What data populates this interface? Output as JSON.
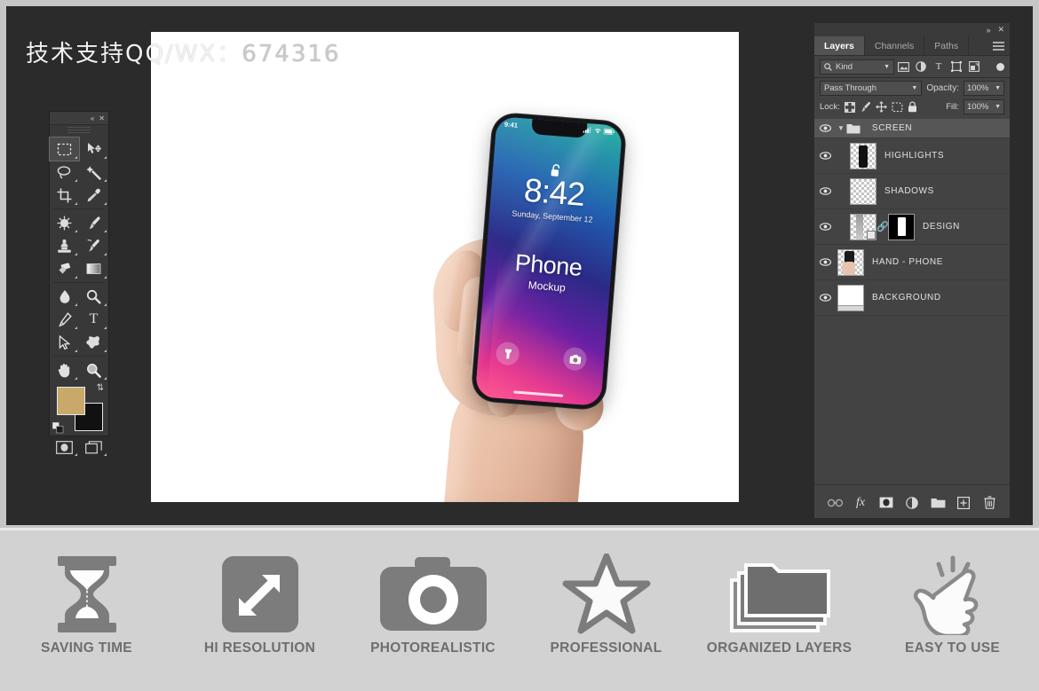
{
  "watermark": {
    "prefix": "技术支持QQ/WX：",
    "code": "674316"
  },
  "toolbar": {
    "collapse_icon": "double-chevron-left",
    "close_icon": "close",
    "tools": [
      {
        "name": "rectangular-marquee-tool",
        "selected": true
      },
      {
        "name": "move-tool",
        "selected": false
      },
      {
        "name": "lasso-tool",
        "selected": false
      },
      {
        "name": "magic-wand-tool",
        "selected": false
      },
      {
        "name": "crop-tool",
        "selected": false
      },
      {
        "name": "eyedropper-tool",
        "selected": false
      },
      {
        "name": "spot-healing-brush-tool",
        "selected": false
      },
      {
        "name": "brush-tool",
        "selected": false
      },
      {
        "name": "clone-stamp-tool",
        "selected": false
      },
      {
        "name": "history-brush-tool",
        "selected": false
      },
      {
        "name": "eraser-tool",
        "selected": false
      },
      {
        "name": "gradient-tool",
        "selected": false
      },
      {
        "name": "blur-tool",
        "selected": false
      },
      {
        "name": "dodge-tool",
        "selected": false
      },
      {
        "name": "pen-tool",
        "selected": false
      },
      {
        "name": "type-tool",
        "selected": false
      },
      {
        "name": "path-selection-tool",
        "selected": false
      },
      {
        "name": "custom-shape-tool",
        "selected": false
      },
      {
        "name": "hand-tool",
        "selected": false
      },
      {
        "name": "zoom-tool",
        "selected": false
      }
    ],
    "foreground_color": "#c9a96a",
    "background_color": "#111111",
    "swap_icon": "swap-colors",
    "default_icon": "default-colors",
    "quick_mask_icon": "quick-mask-mode",
    "screen_mode_icon": "screen-mode"
  },
  "canvas": {
    "phone": {
      "status_time": "9:41",
      "lock_icon": "unlocked-padlock",
      "clock": "8:42",
      "date": "Sunday, September 12",
      "title": "Phone",
      "subtitle": "Mockup",
      "flashlight_icon": "flashlight",
      "camera_icon": "camera",
      "signal_icon": "cellular-signal",
      "wifi_icon": "wifi",
      "battery_icon": "battery"
    }
  },
  "panel": {
    "collapse_icon": "double-chevron-right",
    "close_icon": "close",
    "menu_icon": "panel-menu",
    "tabs": [
      {
        "label": "Layers",
        "active": true
      },
      {
        "label": "Channels",
        "active": false
      },
      {
        "label": "Paths",
        "active": false
      }
    ],
    "filter": {
      "search_icon": "search",
      "kind_label": "Kind",
      "chevron": "chevron-down",
      "buttons": [
        {
          "name": "filter-pixel-layers-icon",
          "glyph": "image"
        },
        {
          "name": "filter-adjustment-layers-icon",
          "glyph": "adjustment"
        },
        {
          "name": "filter-type-layers-icon",
          "glyph": "T"
        },
        {
          "name": "filter-shape-layers-icon",
          "glyph": "shape"
        },
        {
          "name": "filter-smart-objects-icon",
          "glyph": "smart-object"
        }
      ],
      "toggle_name": "filter-enable-toggle"
    },
    "blend": {
      "mode": "Pass Through",
      "opacity_label": "Opacity:",
      "opacity_value": "100%"
    },
    "lock": {
      "label": "Lock:",
      "icons": [
        "lock-transparent-pixels-icon",
        "lock-image-pixels-icon",
        "lock-position-icon",
        "lock-artboard-nesting-icon",
        "lock-all-icon"
      ],
      "fill_label": "Fill:",
      "fill_value": "100%"
    },
    "layers": [
      {
        "name": "SCREEN",
        "type": "group",
        "visible": true,
        "selected": true,
        "expanded": true
      },
      {
        "name": "HIGHLIGHTS",
        "type": "layer",
        "visible": true,
        "selected": false,
        "indent": true
      },
      {
        "name": "SHADOWS",
        "type": "layer",
        "visible": true,
        "selected": false,
        "indent": true
      },
      {
        "name": "DESIGN",
        "type": "smart-object",
        "visible": true,
        "selected": false,
        "indent": true,
        "has_mask": true,
        "linked": true
      },
      {
        "name": "HAND - PHONE",
        "type": "layer",
        "visible": true,
        "selected": false,
        "indent": false
      },
      {
        "name": "BACKGROUND",
        "type": "layer",
        "visible": true,
        "selected": false,
        "indent": false
      }
    ],
    "bottom_buttons": [
      {
        "name": "link-layers-icon",
        "glyph": "link"
      },
      {
        "name": "layer-style-fx-icon",
        "glyph": "fx"
      },
      {
        "name": "add-layer-mask-icon",
        "glyph": "mask"
      },
      {
        "name": "new-adjustment-layer-icon",
        "glyph": "adjustment"
      },
      {
        "name": "new-group-icon",
        "glyph": "folder"
      },
      {
        "name": "new-layer-icon",
        "glyph": "plus"
      },
      {
        "name": "delete-layer-icon",
        "glyph": "trash"
      }
    ]
  },
  "features": [
    {
      "label": "SAVING TIME",
      "icon": "hourglass-icon"
    },
    {
      "label": "HI RESOLUTION",
      "icon": "resize-arrows-icon"
    },
    {
      "label": "PHOTOREALISTIC",
      "icon": "camera-icon"
    },
    {
      "label": "PROFESSIONAL",
      "icon": "star-icon"
    },
    {
      "label": "ORGANIZED LAYERS",
      "icon": "layered-folders-icon"
    },
    {
      "label": "EASY TO USE",
      "icon": "tap-hand-icon"
    }
  ]
}
